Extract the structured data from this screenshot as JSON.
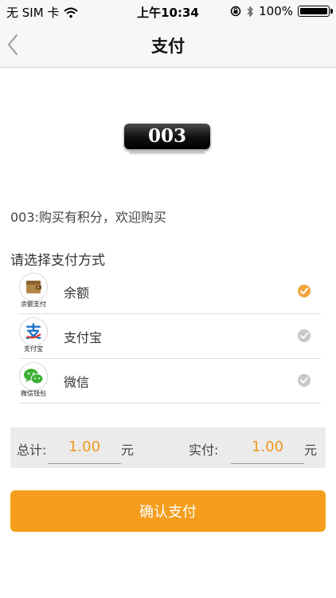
{
  "status_bar": {
    "carrier": "无 SIM 卡",
    "time": "上午10:34",
    "battery_text": "100%",
    "battery_level": 1.0,
    "icons": [
      "wifi-icon",
      "rotation-lock-icon",
      "bluetooth-icon",
      "battery-icon"
    ]
  },
  "nav": {
    "title": "支付",
    "back_icon": "chevron-left-icon"
  },
  "product": {
    "code": "003",
    "description": "003:购买有积分，欢迎购买"
  },
  "payment": {
    "title": "请选择支付方式",
    "methods": [
      {
        "name": "余额",
        "caption": "余额支付",
        "icon": "wallet-icon",
        "selected": true
      },
      {
        "name": "支付宝",
        "caption": "支付宝",
        "icon": "alipay-icon",
        "selected": false
      },
      {
        "name": "微信",
        "caption": "微信钱包",
        "icon": "wechat-icon",
        "selected": false
      }
    ],
    "colors": {
      "selected": "#f0a63f",
      "unselected": "#c8c8c8"
    }
  },
  "totals": {
    "total_label": "总计:",
    "total_value": "1.00",
    "actual_label": "实付:",
    "actual_value": "1.00",
    "unit": "元"
  },
  "confirm": {
    "label": "确认支付",
    "color": "#f59e1d"
  }
}
